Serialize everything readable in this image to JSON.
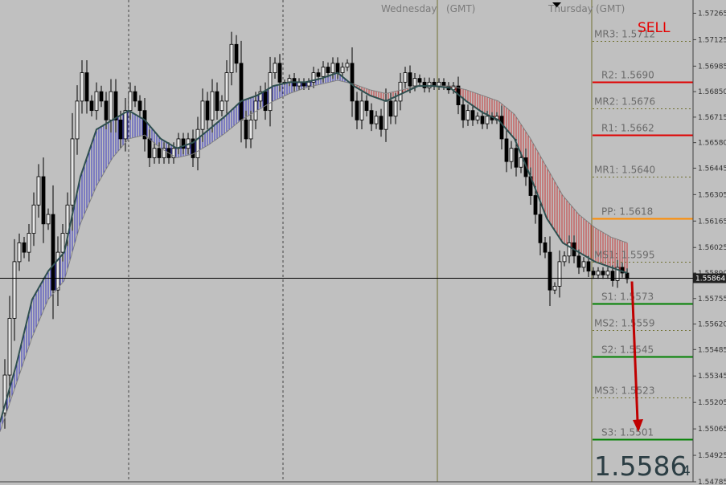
{
  "chart_data": {
    "type": "candlestick",
    "symbol_digits": 5,
    "ylim": [
      1.54785,
      1.57335
    ],
    "y_ticks": [
      1.57265,
      1.57125,
      1.56985,
      1.5685,
      1.56715,
      1.5658,
      1.56445,
      1.56305,
      1.56165,
      1.56025,
      1.5589,
      1.55755,
      1.5562,
      1.55485,
      1.55345,
      1.55205,
      1.55065,
      1.54925,
      1.54785
    ],
    "y_tick_labels": [
      "1.57265",
      "1.57125",
      "1.56985",
      "1.56850",
      "1.56715",
      "1.56580",
      "1.56445",
      "1.56305",
      "1.56165",
      "1.56025",
      "1.55890",
      "1.55755",
      "1.55620",
      "1.55485",
      "1.55345",
      "1.55205",
      "1.55065",
      "1.54925",
      "1.54785"
    ],
    "current_price": 1.55864,
    "current_price_label": "1.55864",
    "day_labels": [
      {
        "name": "Wednesday",
        "tz": "(GMT)"
      },
      {
        "name": "Thursday",
        "tz": "(GMT)"
      }
    ],
    "signal": "SELL",
    "big_price": {
      "main": "1.5586",
      "last_digit": "4"
    },
    "pivot_levels": [
      {
        "label": "MR3",
        "value": 1.5712,
        "value_label": "1.5712",
        "kind": "mid"
      },
      {
        "label": "R2",
        "value": 1.569,
        "value_label": "1.5690",
        "kind": "resistance"
      },
      {
        "label": "MR2",
        "value": 1.5676,
        "value_label": "1.5676",
        "kind": "mid"
      },
      {
        "label": "R1",
        "value": 1.5662,
        "value_label": "1.5662",
        "kind": "resistance"
      },
      {
        "label": "MR1",
        "value": 1.564,
        "value_label": "1.5640",
        "kind": "mid"
      },
      {
        "label": "PP",
        "value": 1.5618,
        "value_label": "1.5618",
        "kind": "pivot"
      },
      {
        "label": "MS1",
        "value": 1.5595,
        "value_label": "1.5595",
        "kind": "mid"
      },
      {
        "label": "S1",
        "value": 1.5573,
        "value_label": "1.5573",
        "kind": "support"
      },
      {
        "label": "MS2",
        "value": 1.5559,
        "value_label": "1.5559",
        "kind": "mid"
      },
      {
        "label": "S2",
        "value": 1.5545,
        "value_label": "1.5545",
        "kind": "support"
      },
      {
        "label": "MS3",
        "value": 1.5523,
        "value_label": "1.5523",
        "kind": "mid"
      },
      {
        "label": "S3",
        "value": 1.5501,
        "value_label": "1.5501",
        "kind": "support"
      }
    ],
    "price_path": [
      [
        0,
        1.5515
      ],
      [
        6,
        1.5535
      ],
      [
        12,
        1.5565
      ],
      [
        18,
        1.5595
      ],
      [
        24,
        1.5605
      ],
      [
        30,
        1.56
      ],
      [
        36,
        1.561
      ],
      [
        42,
        1.5625
      ],
      [
        48,
        1.564
      ],
      [
        54,
        1.5615
      ],
      [
        60,
        1.562
      ],
      [
        66,
        1.558
      ],
      [
        72,
        1.56
      ],
      [
        78,
        1.561
      ],
      [
        84,
        1.5625
      ],
      [
        90,
        1.566
      ],
      [
        96,
        1.568
      ],
      [
        102,
        1.5695
      ],
      [
        108,
        1.568
      ],
      [
        114,
        1.5675
      ],
      [
        120,
        1.5685
      ],
      [
        126,
        1.568
      ],
      [
        132,
        1.567
      ],
      [
        138,
        1.5685
      ],
      [
        144,
        1.567
      ],
      [
        150,
        1.566
      ],
      [
        156,
        1.5675
      ],
      [
        162,
        1.5685
      ],
      [
        168,
        1.568
      ],
      [
        174,
        1.5675
      ],
      [
        180,
        1.566
      ],
      [
        186,
        1.565
      ],
      [
        192,
        1.5655
      ],
      [
        198,
        1.565
      ],
      [
        204,
        1.5655
      ],
      [
        210,
        1.565
      ],
      [
        216,
        1.5655
      ],
      [
        222,
        1.566
      ],
      [
        228,
        1.5655
      ],
      [
        234,
        1.566
      ],
      [
        240,
        1.565
      ],
      [
        246,
        1.5665
      ],
      [
        252,
        1.568
      ],
      [
        258,
        1.567
      ],
      [
        264,
        1.5685
      ],
      [
        270,
        1.5675
      ],
      [
        276,
        1.568
      ],
      [
        282,
        1.5695
      ],
      [
        288,
        1.571
      ],
      [
        294,
        1.57
      ],
      [
        300,
        1.567
      ],
      [
        306,
        1.566
      ],
      [
        312,
        1.567
      ],
      [
        318,
        1.568
      ],
      [
        324,
        1.5685
      ],
      [
        330,
        1.5675
      ],
      [
        336,
        1.5695
      ],
      [
        342,
        1.57
      ],
      [
        348,
        1.569
      ],
      [
        354,
        1.569
      ],
      [
        360,
        1.5692
      ],
      [
        366,
        1.5688
      ],
      [
        372,
        1.569
      ],
      [
        378,
        1.5688
      ],
      [
        384,
        1.569
      ],
      [
        390,
        1.5695
      ],
      [
        396,
        1.5693
      ],
      [
        402,
        1.5698
      ],
      [
        408,
        1.5695
      ],
      [
        414,
        1.57
      ],
      [
        420,
        1.5695
      ],
      [
        426,
        1.5698
      ],
      [
        432,
        1.57
      ],
      [
        438,
        1.568
      ],
      [
        444,
        1.567
      ],
      [
        450,
        1.568
      ],
      [
        456,
        1.5675
      ],
      [
        462,
        1.5668
      ],
      [
        468,
        1.5672
      ],
      [
        474,
        1.5665
      ],
      [
        480,
        1.568
      ],
      [
        486,
        1.5672
      ],
      [
        492,
        1.568
      ],
      [
        498,
        1.569
      ],
      [
        504,
        1.5695
      ],
      [
        510,
        1.5688
      ],
      [
        516,
        1.5692
      ],
      [
        522,
        1.569
      ],
      [
        528,
        1.5687
      ],
      [
        534,
        1.569
      ],
      [
        540,
        1.5688
      ],
      [
        546,
        1.569
      ],
      [
        552,
        1.5688
      ],
      [
        558,
        1.5686
      ],
      [
        564,
        1.5688
      ],
      [
        570,
        1.5678
      ],
      [
        576,
        1.567
      ],
      [
        582,
        1.5675
      ],
      [
        588,
        1.567
      ],
      [
        594,
        1.5672
      ],
      [
        600,
        1.5668
      ],
      [
        606,
        1.5672
      ],
      [
        612,
        1.567
      ],
      [
        618,
        1.5672
      ],
      [
        624,
        1.566
      ],
      [
        630,
        1.5648
      ],
      [
        636,
        1.5655
      ],
      [
        642,
        1.5645
      ],
      [
        648,
        1.565
      ],
      [
        654,
        1.564
      ],
      [
        660,
        1.563
      ],
      [
        666,
        1.562
      ],
      [
        672,
        1.5605
      ],
      [
        678,
        1.56
      ],
      [
        684,
        1.558
      ],
      [
        690,
        1.5582
      ],
      [
        696,
        1.5595
      ],
      [
        702,
        1.5598
      ],
      [
        708,
        1.5605
      ],
      [
        714,
        1.5598
      ],
      [
        720,
        1.5592
      ],
      [
        726,
        1.5595
      ],
      [
        732,
        1.559
      ],
      [
        738,
        1.5588
      ],
      [
        744,
        1.559
      ],
      [
        750,
        1.5588
      ],
      [
        756,
        1.559
      ],
      [
        762,
        1.5585
      ],
      [
        768,
        1.5592
      ],
      [
        774,
        1.5589
      ],
      [
        780,
        1.5586
      ]
    ],
    "ma_fast": [
      [
        0,
        1.551
      ],
      [
        20,
        1.554
      ],
      [
        40,
        1.5575
      ],
      [
        60,
        1.559
      ],
      [
        80,
        1.56
      ],
      [
        100,
        1.564
      ],
      [
        120,
        1.5665
      ],
      [
        140,
        1.567
      ],
      [
        160,
        1.5675
      ],
      [
        180,
        1.567
      ],
      [
        200,
        1.566
      ],
      [
        220,
        1.5655
      ],
      [
        240,
        1.5658
      ],
      [
        260,
        1.5665
      ],
      [
        280,
        1.5672
      ],
      [
        300,
        1.568
      ],
      [
        320,
        1.5683
      ],
      [
        340,
        1.5688
      ],
      [
        360,
        1.569
      ],
      [
        380,
        1.569
      ],
      [
        400,
        1.5692
      ],
      [
        420,
        1.5695
      ],
      [
        440,
        1.5688
      ],
      [
        460,
        1.5683
      ],
      [
        480,
        1.568
      ],
      [
        500,
        1.5684
      ],
      [
        520,
        1.5688
      ],
      [
        540,
        1.5688
      ],
      [
        560,
        1.5687
      ],
      [
        580,
        1.568
      ],
      [
        600,
        1.5674
      ],
      [
        620,
        1.567
      ],
      [
        640,
        1.566
      ],
      [
        660,
        1.564
      ],
      [
        680,
        1.5618
      ],
      [
        700,
        1.5605
      ],
      [
        720,
        1.56
      ],
      [
        740,
        1.5595
      ],
      [
        760,
        1.5592
      ],
      [
        780,
        1.5589
      ]
    ],
    "ma_slow": [
      [
        0,
        1.5505
      ],
      [
        20,
        1.553
      ],
      [
        40,
        1.5555
      ],
      [
        60,
        1.5575
      ],
      [
        80,
        1.5585
      ],
      [
        100,
        1.5615
      ],
      [
        120,
        1.5635
      ],
      [
        140,
        1.565
      ],
      [
        160,
        1.566
      ],
      [
        180,
        1.5662
      ],
      [
        200,
        1.5655
      ],
      [
        220,
        1.565
      ],
      [
        240,
        1.5652
      ],
      [
        260,
        1.5657
      ],
      [
        280,
        1.5663
      ],
      [
        300,
        1.567
      ],
      [
        320,
        1.5675
      ],
      [
        340,
        1.568
      ],
      [
        360,
        1.5684
      ],
      [
        380,
        1.5687
      ],
      [
        400,
        1.5689
      ],
      [
        420,
        1.5691
      ],
      [
        440,
        1.5689
      ],
      [
        460,
        1.5686
      ],
      [
        480,
        1.5684
      ],
      [
        500,
        1.5686
      ],
      [
        520,
        1.5688
      ],
      [
        540,
        1.5688
      ],
      [
        560,
        1.5688
      ],
      [
        580,
        1.5686
      ],
      [
        600,
        1.5683
      ],
      [
        620,
        1.568
      ],
      [
        640,
        1.5673
      ],
      [
        660,
        1.566
      ],
      [
        680,
        1.5645
      ],
      [
        700,
        1.563
      ],
      [
        720,
        1.562
      ],
      [
        740,
        1.5613
      ],
      [
        760,
        1.5608
      ],
      [
        780,
        1.5605
      ]
    ]
  },
  "colors": {
    "background": "#c0c0c0",
    "bull_candle": "#e8e8e8",
    "bear_candle": "#000000",
    "ma_fast": "#2f4f4f",
    "cloud_bull": "#2020c0",
    "cloud_bear": "#c81e1e",
    "resistance": "#e00000",
    "support": "#008000",
    "pivot": "#ff8c00",
    "mid_level": "#707030",
    "day_divider": "#707030",
    "signal": "#e60000",
    "arrow": "#c00000",
    "price_line": "#000000",
    "price_box": "#202020"
  }
}
